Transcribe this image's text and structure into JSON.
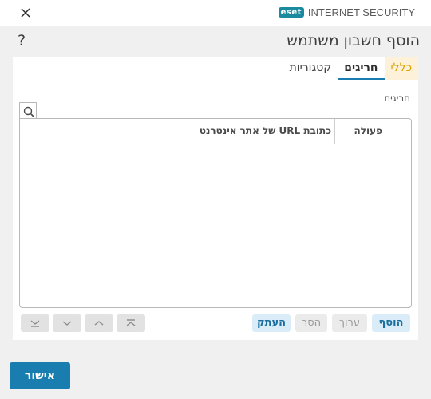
{
  "titlebar": {
    "brand_badge": "eset",
    "brand_name": "INTERNET SECURITY",
    "brand_color": "#1a8a9e"
  },
  "dialog": {
    "title": "הוסף חשבון משתמש",
    "help_label": "?"
  },
  "tabs": [
    {
      "label": "כללי",
      "state": "inactive"
    },
    {
      "label": "חריגים",
      "state": "active"
    },
    {
      "label": "קטגוריות",
      "state": "inactive"
    }
  ],
  "section": {
    "label": "חריגים"
  },
  "table": {
    "columns": [
      "פעולה",
      "כתובת URL של אתר אינטרנט"
    ],
    "rows": []
  },
  "actions": {
    "add": "הוסף",
    "edit": "ערוך",
    "remove": "הסר",
    "copy": "העתק"
  },
  "icons": {
    "close": "close-icon",
    "search": "search-icon",
    "move_bottom": "move-bottom-icon",
    "move_down": "chevron-down-icon",
    "move_up": "chevron-up-icon",
    "move_top": "move-top-icon"
  },
  "footer": {
    "ok_label": "אישור"
  },
  "colors": {
    "accent": "#1a7db0",
    "general_tab_bg": "#fdf1d9",
    "general_tab_text": "#d9a100"
  }
}
